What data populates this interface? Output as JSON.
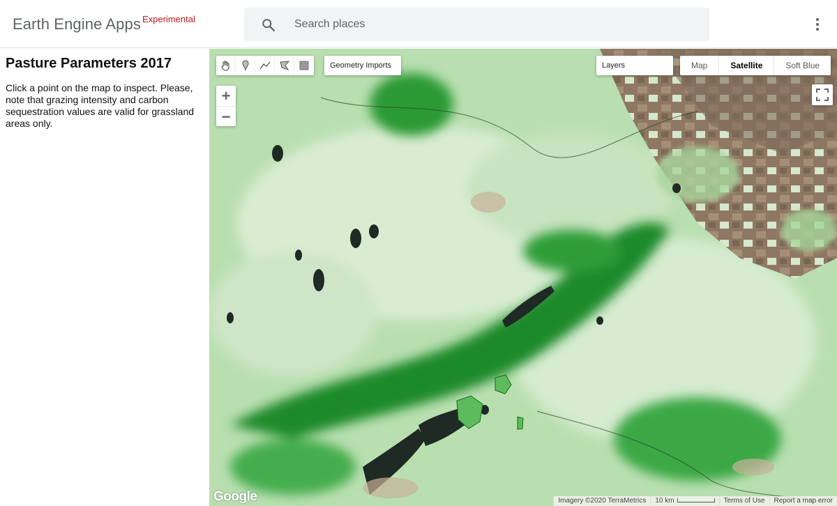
{
  "header": {
    "brand": "Earth Engine Apps",
    "brand_tag": "Experimental",
    "search": {
      "placeholder": "Search places",
      "value": ""
    },
    "icons": [
      "search-icon",
      "more-vert-icon"
    ]
  },
  "panel": {
    "title": "Pasture Parameters 2017",
    "description": "Click a point on the map to inspect. Please, note that grazing intensity and carbon sequestration values are valid for grassland areas only."
  },
  "map": {
    "drawing_tools": [
      "hand-icon",
      "placemark-icon",
      "line-icon",
      "polygon-icon",
      "rectangle-icon"
    ],
    "geometry_imports": "Geometry Imports",
    "layers": "Layers",
    "map_types": [
      {
        "label": "Map",
        "active": false
      },
      {
        "label": "Satellite",
        "active": true
      },
      {
        "label": "Soft Blue",
        "active": false
      }
    ],
    "zoom_in": "+",
    "zoom_out": "−",
    "google": "Google",
    "attribution": {
      "imagery": "Imagery ©2020 TerraMetrics",
      "scale": "10 km",
      "terms": "Terms of Use",
      "report": "Report a map error"
    }
  },
  "colors": {
    "brand_tag": "#b71c1c",
    "vegetation_dark": "#1f8a2a",
    "vegetation_light": "#cfe9c8",
    "cropland": "#8b7060",
    "water": "#1f2a24"
  }
}
